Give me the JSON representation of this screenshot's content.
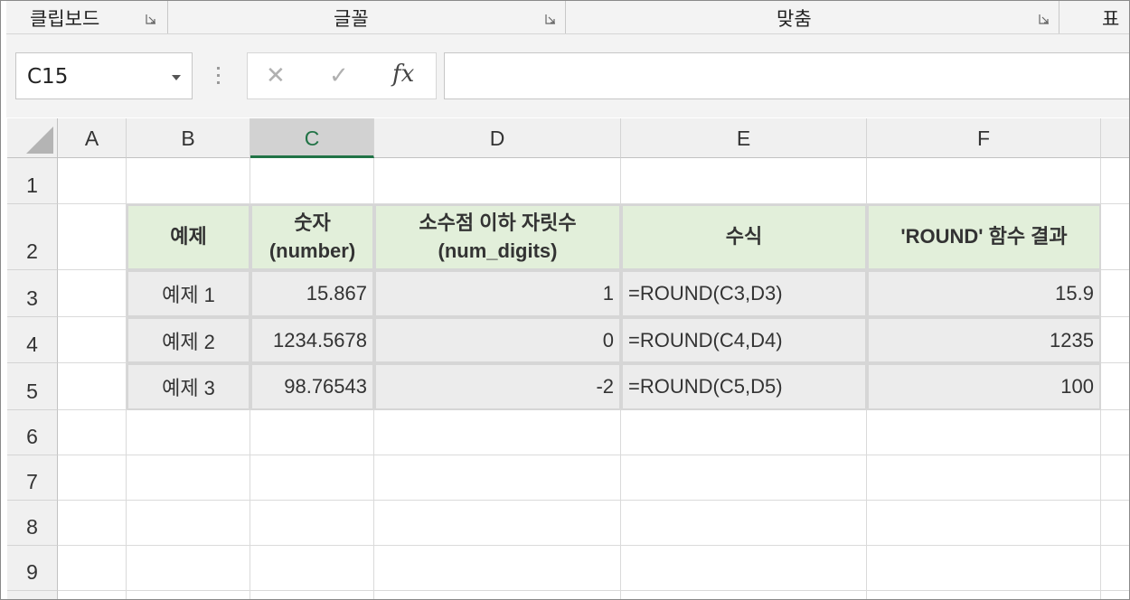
{
  "ribbon": {
    "groups": [
      {
        "label": "클립보드"
      },
      {
        "label": "글꼴"
      },
      {
        "label": "맞춤"
      },
      {
        "label": "표"
      }
    ]
  },
  "formula_bar": {
    "name_box": "C15",
    "formula": "",
    "cancel_symbol": "✕",
    "enter_symbol": "✓",
    "fx_label": "fx"
  },
  "columns": [
    "A",
    "B",
    "C",
    "D",
    "E",
    "F"
  ],
  "selected_column": "C",
  "rows": [
    "1",
    "2",
    "3",
    "4",
    "5",
    "6",
    "7",
    "8",
    "9"
  ],
  "table": {
    "headers": {
      "b": "예제",
      "c_line1": "숫자",
      "c_line2": "(number)",
      "d_line1": "소수점 이하 자릿수",
      "d_line2": "(num_digits)",
      "e": "수식",
      "f": "'ROUND' 함수 결과"
    },
    "rows": [
      {
        "example": "예제 1",
        "number": "15.867",
        "digits": "1",
        "formula": "=ROUND(C3,D3)",
        "result": "15.9"
      },
      {
        "example": "예제 2",
        "number": "1234.5678",
        "digits": "0",
        "formula": "=ROUND(C4,D4)",
        "result": "1235"
      },
      {
        "example": "예제 3",
        "number": "98.76543",
        "digits": "-2",
        "formula": "=ROUND(C5,D5)",
        "result": "100"
      }
    ]
  },
  "colors": {
    "header_fill": "#e2efda",
    "data_fill": "#ececec",
    "excel_green": "#217346"
  }
}
